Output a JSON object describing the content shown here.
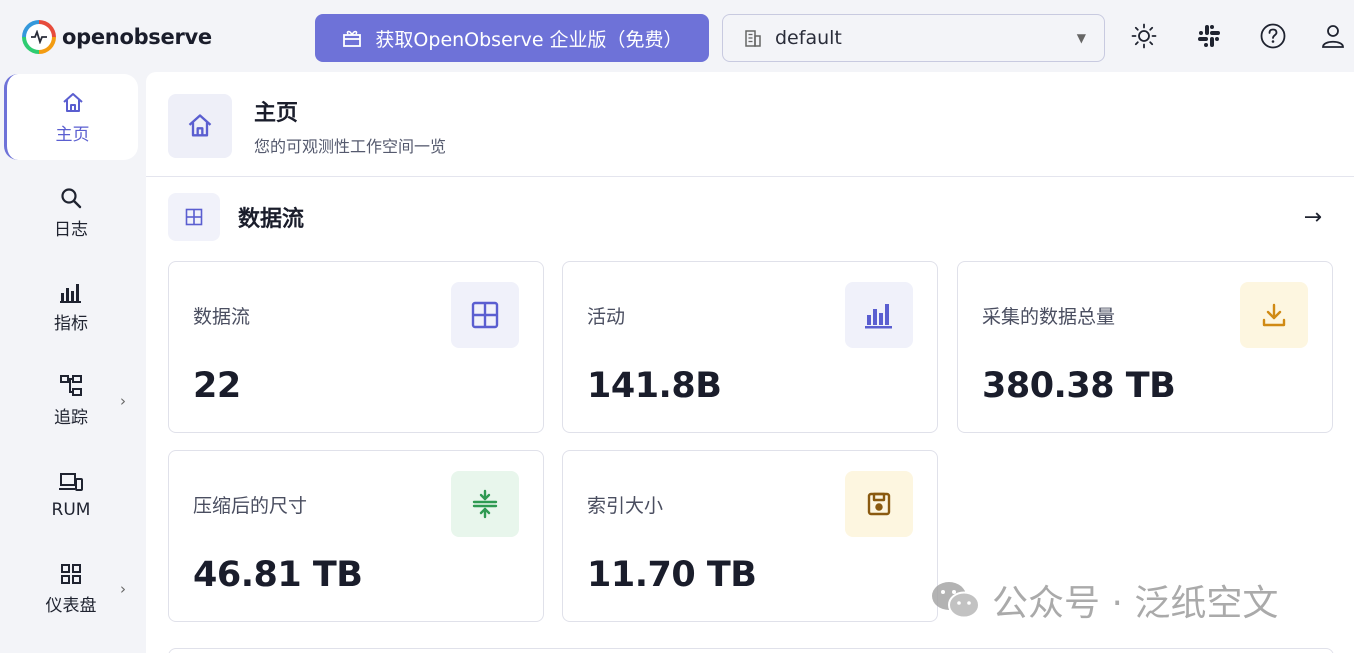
{
  "app": {
    "logo_text": "openobserve"
  },
  "topbar": {
    "enterprise_button": "获取OpenObserve 企业版（免费）",
    "org_select": {
      "value": "default"
    },
    "icons": [
      "sun-icon",
      "slack-icon",
      "help-icon",
      "user-icon"
    ]
  },
  "sidebar": {
    "items": [
      {
        "label": "主页",
        "icon": "home-icon",
        "active": true
      },
      {
        "label": "日志",
        "icon": "search-icon"
      },
      {
        "label": "指标",
        "icon": "bar-chart-icon"
      },
      {
        "label": "追踪",
        "icon": "trace-icon",
        "has_submenu": true
      },
      {
        "label": "RUM",
        "icon": "devices-icon"
      },
      {
        "label": "仪表盘",
        "icon": "dashboard-grid-icon",
        "has_submenu": true
      }
    ]
  },
  "page": {
    "title": "主页",
    "subtitle": "您的可观测性工作空间一览"
  },
  "section": {
    "title": "数据流"
  },
  "cards": [
    {
      "label": "数据流",
      "value": "22",
      "icon": "grid-icon",
      "icon_color": "#5a5ed0",
      "icon_bg": "#f0f1fa"
    },
    {
      "label": "活动",
      "value": "141.8B",
      "icon": "bar-chart-icon",
      "icon_color": "#5a5ed0",
      "icon_bg": "#f0f1fa"
    },
    {
      "label": "采集的数据总量",
      "value": "380.38 TB",
      "icon": "download-icon",
      "icon_color": "#d08a14",
      "icon_bg": "#fdf6e0"
    },
    {
      "label": "压缩后的尺寸",
      "value": "46.81 TB",
      "icon": "compress-icon",
      "icon_color": "#2f9a52",
      "icon_bg": "#e8f6ec"
    },
    {
      "label": "索引大小",
      "value": "11.70 TB",
      "icon": "save-icon",
      "icon_color": "#8a5a10",
      "icon_bg": "#fdf6e0"
    }
  ],
  "watermark": {
    "text": "公众号 · 泛纸空文"
  }
}
